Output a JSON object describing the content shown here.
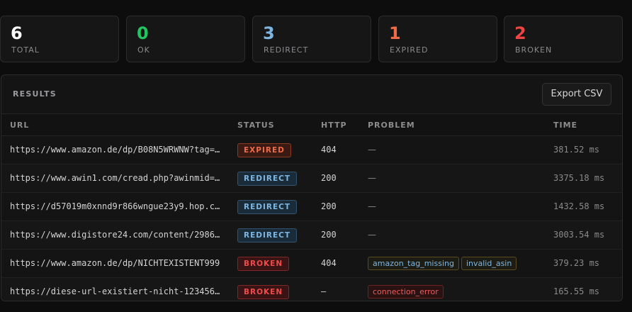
{
  "stats": [
    {
      "value": "6",
      "label": "TOTAL",
      "color": "#ffffff"
    },
    {
      "value": "0",
      "label": "OK",
      "color": "#22c55e"
    },
    {
      "value": "3",
      "label": "REDIRECT",
      "color": "#7fb6e0"
    },
    {
      "value": "1",
      "label": "EXPIRED",
      "color": "#f06a47"
    },
    {
      "value": "2",
      "label": "BROKEN",
      "color": "#ef4444"
    }
  ],
  "results": {
    "title": "RESULTS",
    "export_label": "Export CSV",
    "columns": {
      "url": "URL",
      "status": "STATUS",
      "http": "HTTP",
      "problem": "PROBLEM",
      "time": "TIME"
    },
    "rows": [
      {
        "url": "https://www.amazon.de/dp/B08N5WRWNW?tag=t…",
        "status": "EXPIRED",
        "status_kind": "expired",
        "http": "404",
        "problems": [],
        "problem_text": "—",
        "time": "381.52 ms"
      },
      {
        "url": "https://www.awin1.com/cread.php?awinmid=1…",
        "status": "REDIRECT",
        "status_kind": "redirect",
        "http": "200",
        "problems": [],
        "problem_text": "—",
        "time": "3375.18 ms"
      },
      {
        "url": "https://d57019m0xnnd9r866wngue23y9.hop.cl…",
        "status": "REDIRECT",
        "status_kind": "redirect",
        "http": "200",
        "problems": [],
        "problem_text": "—",
        "time": "1432.58 ms"
      },
      {
        "url": "https://www.digistore24.com/content/29866…",
        "status": "REDIRECT",
        "status_kind": "redirect",
        "http": "200",
        "problems": [],
        "problem_text": "—",
        "time": "3003.54 ms"
      },
      {
        "url": "https://www.amazon.de/dp/NICHTEXISTENT999",
        "status": "BROKEN",
        "status_kind": "broken",
        "http": "404",
        "problems": [
          {
            "text": "amazon_tag_missing",
            "kind": "warn"
          },
          {
            "text": "invalid_asin",
            "kind": "warn"
          }
        ],
        "problem_text": "",
        "time": "379.23 ms"
      },
      {
        "url": "https://diese-url-existiert-nicht-123456.…",
        "status": "BROKEN",
        "status_kind": "broken",
        "http": "—",
        "problems": [
          {
            "text": "connection_error",
            "kind": "err"
          }
        ],
        "problem_text": "",
        "time": "165.55 ms"
      }
    ]
  }
}
